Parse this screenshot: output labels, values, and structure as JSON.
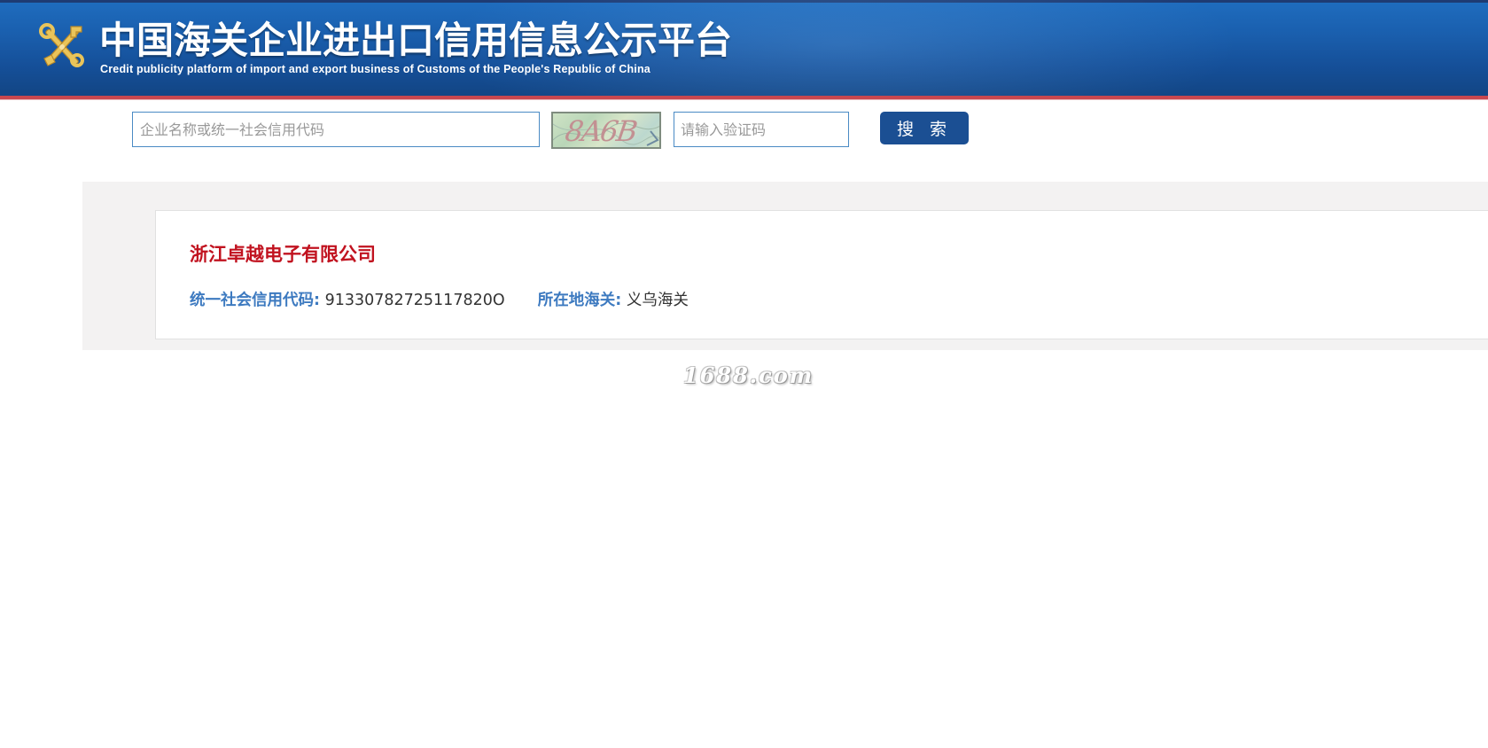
{
  "header": {
    "title": "中国海关企业进出口信用信息公示平台",
    "subtitle": "Credit publicity platform of import and export business of Customs of the People's Republic of China",
    "emblem_icon": "customs-emblem-icon",
    "colors": {
      "banner": "#1a5fae",
      "stripe": "#c8474f"
    }
  },
  "search": {
    "company_placeholder": "企业名称或统一社会信用代码",
    "company_value": "",
    "captcha_text": "8A6B",
    "verify_placeholder": "请输入验证码",
    "verify_value": "",
    "button_label": "搜 索",
    "button_color": "#1b4f93"
  },
  "result": {
    "company_name": "浙江卓越电子有限公司",
    "credit_code_label": "统一社会信用代码:",
    "credit_code_value": "91330782725117820O",
    "customs_label": "所在地海关:",
    "customs_value": "义乌海关",
    "name_color": "#c1121f",
    "label_color": "#3d7ac0"
  },
  "watermark": {
    "text": "1688.com"
  }
}
